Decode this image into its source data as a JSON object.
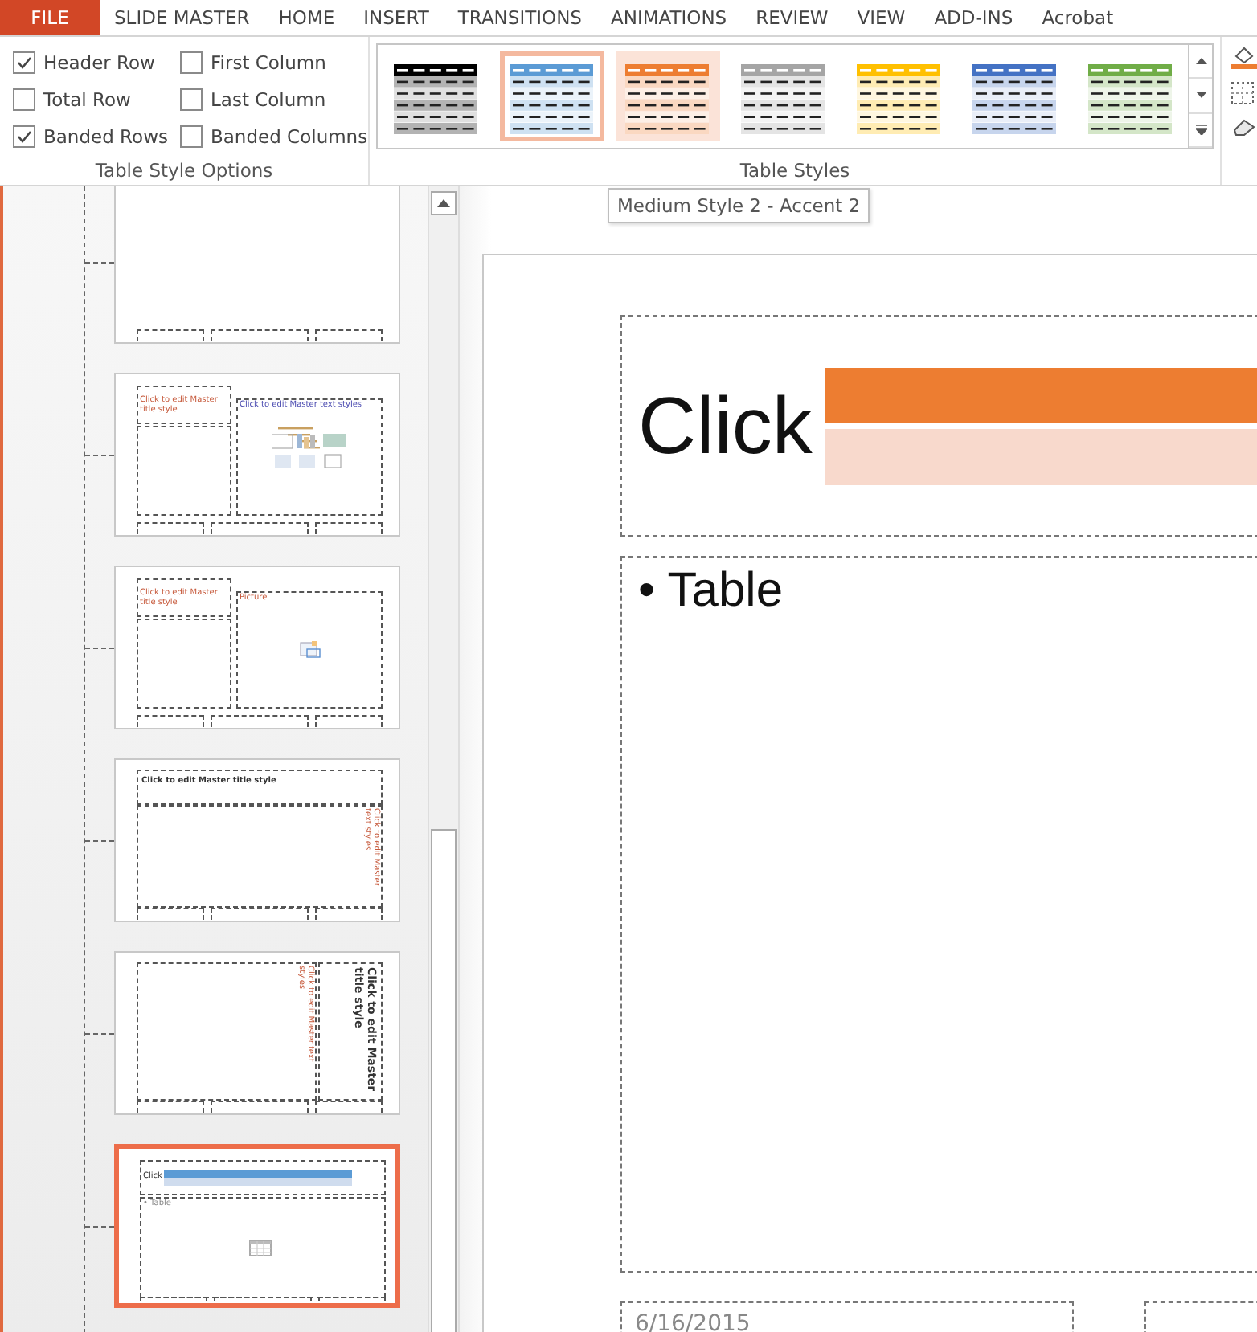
{
  "ribbon": {
    "tabs": [
      {
        "label": "FILE",
        "kind": "file"
      },
      {
        "label": "SLIDE MASTER",
        "kind": "tab"
      },
      {
        "label": "HOME",
        "kind": "tab"
      },
      {
        "label": "INSERT",
        "kind": "tab"
      },
      {
        "label": "TRANSITIONS",
        "kind": "tab"
      },
      {
        "label": "ANIMATIONS",
        "kind": "tab"
      },
      {
        "label": "REVIEW",
        "kind": "tab"
      },
      {
        "label": "VIEW",
        "kind": "tab"
      },
      {
        "label": "ADD-INS",
        "kind": "tab"
      },
      {
        "label": "Acrobat",
        "kind": "tab"
      }
    ],
    "style_options": {
      "label": "Table Style Options",
      "options": [
        {
          "label": "Header Row",
          "checked": true
        },
        {
          "label": "Total Row",
          "checked": false
        },
        {
          "label": "Banded Rows",
          "checked": true
        },
        {
          "label": "First Column",
          "checked": false
        },
        {
          "label": "Last Column",
          "checked": false
        },
        {
          "label": "Banded Columns",
          "checked": false
        }
      ]
    },
    "table_styles": {
      "label": "Table Styles",
      "styles": [
        {
          "color": "#000000",
          "selected": false,
          "hovered": false
        },
        {
          "color": "#5b9bd5",
          "selected": true,
          "hovered": false
        },
        {
          "color": "#ed7d31",
          "selected": false,
          "hovered": true
        },
        {
          "color": "#a5a5a5",
          "selected": false,
          "hovered": false
        },
        {
          "color": "#ffc000",
          "selected": false,
          "hovered": false
        },
        {
          "color": "#4472c4",
          "selected": false,
          "hovered": false
        },
        {
          "color": "#70ad47",
          "selected": false,
          "hovered": false
        }
      ]
    },
    "tooltip": "Medium Style 2 - Accent 2"
  },
  "thumbnails": [
    {
      "kind": "blank",
      "selected": false
    },
    {
      "kind": "two_content",
      "title": "Click to edit Master title style",
      "body": "Click to edit Master text styles",
      "selected": false
    },
    {
      "kind": "picture",
      "title": "Click to edit Master title style",
      "body": "Picture",
      "selected": false
    },
    {
      "kind": "vertical_body",
      "title": "Click to edit Master title style",
      "body": "Click to edit Master text styles",
      "selected": false
    },
    {
      "kind": "vertical_title",
      "title": "Click to edit Master title style",
      "body": "Click to edit Master text styles",
      "selected": false
    },
    {
      "kind": "table",
      "title": "Click",
      "body": "• Table",
      "selected": true
    }
  ],
  "slide": {
    "title": "Click",
    "body": "• Table",
    "date": "6/16/2015"
  }
}
